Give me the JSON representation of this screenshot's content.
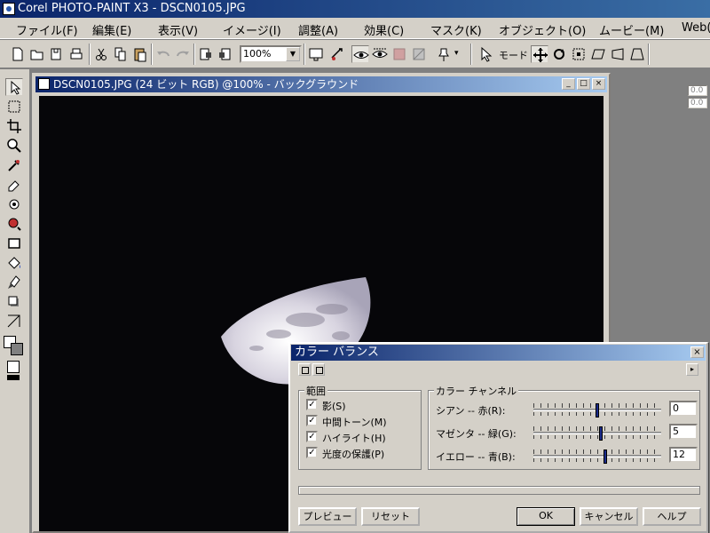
{
  "app": {
    "title": "Corel PHOTO-PAINT X3 - DSCN0105.JPG"
  },
  "menubar": {
    "items": [
      "ファイル(F)",
      "編集(E)",
      "表示(V)",
      "イメージ(I)",
      "調整(A)",
      "効果(C)",
      "マスク(K)",
      "オブジェクト(O)",
      "ムービー(M)",
      "Web("
    ]
  },
  "toolbar": {
    "zoom": "100%",
    "mode_label": "モード",
    "zoom_arrow": "▼",
    "mode_arrow": "▾",
    "value_placeholders": [
      "0.0",
      "0.0"
    ]
  },
  "document": {
    "title": "DSCN0105.JPG (24 ビット RGB) @100% - バックグラウンド",
    "buttons": {
      "minimize": "_",
      "maximize": "□",
      "close": "×"
    }
  },
  "dialog": {
    "title": "カラー バランス",
    "close": "×",
    "menu_arrow": "▸",
    "range_group": {
      "label": "範囲",
      "checkboxes": [
        {
          "label": "影(S)",
          "checked": true
        },
        {
          "label": "中間トーン(M)",
          "checked": true
        },
        {
          "label": "ハイライト(H)",
          "checked": true
        },
        {
          "label": "光度の保護(P)",
          "checked": true
        }
      ]
    },
    "channel_group": {
      "label": "カラー チャンネル",
      "sliders": [
        {
          "label": "シアン -- 赤(R):",
          "value": "0",
          "position": 0
        },
        {
          "label": "マゼンタ -- 緑(G):",
          "value": "5",
          "position": 5
        },
        {
          "label": "イエロー -- 青(B):",
          "value": "12",
          "position": 12
        }
      ]
    },
    "buttons": {
      "preview": "プレビュー",
      "reset": "リセット",
      "ok": "OK",
      "cancel": "キャンセル",
      "help": "ヘルプ"
    }
  },
  "colors": {
    "title_active": "#0a246a",
    "face": "#d4d0c8",
    "canvas": "#060609"
  },
  "icons": {
    "toolbar": [
      "new-icon",
      "open-icon",
      "save-icon",
      "print-icon",
      "cut-icon",
      "copy-icon",
      "paste-icon",
      "undo-icon",
      "redo-icon",
      "import-icon",
      "export-icon",
      "full-screen-icon",
      "lasso-icon",
      "eye-icon",
      "mask-overlay-icon",
      "mask-icon",
      "mask-marquee-icon",
      "pin-icon",
      "pick-icon",
      "move-icon",
      "rotate-icon",
      "scale-icon",
      "skew-icon",
      "distort-icon",
      "perspective-icon"
    ],
    "toolbox": [
      "pick-tool-icon",
      "mask-tool-icon",
      "crop-tool-icon",
      "zoom-tool-icon",
      "eyedropper-tool-icon",
      "eraser-tool-icon",
      "redeye-tool-icon",
      "clone-tool-icon",
      "rectangle-tool-icon",
      "fill-tool-icon",
      "brush-tool-icon",
      "shadow-tool-icon",
      "effect-tool-icon"
    ]
  }
}
